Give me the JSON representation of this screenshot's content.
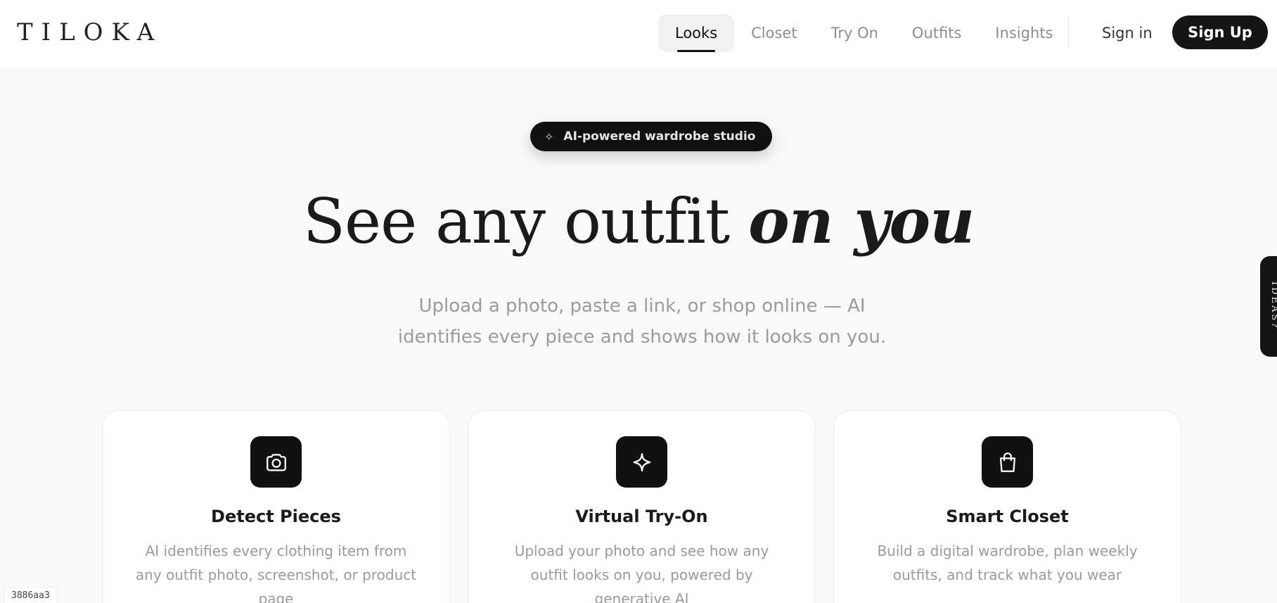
{
  "header": {
    "logo": "TILOKA",
    "nav": [
      {
        "label": "Looks",
        "active": true
      },
      {
        "label": "Closet",
        "active": false
      },
      {
        "label": "Try On",
        "active": false
      },
      {
        "label": "Outfits",
        "active": false
      },
      {
        "label": "Insights",
        "active": false
      }
    ],
    "sign_in": "Sign in",
    "sign_up": "Sign Up"
  },
  "hero": {
    "badge_icon": "sparkle-icon",
    "badge": "AI-powered wardrobe studio",
    "title_plain": "See any outfit",
    "title_emphasis": "on you",
    "subtitle": "Upload a photo, paste a link, or shop online — AI identifies every piece and shows how it looks on you."
  },
  "side_tab": {
    "label": "IDEAS?"
  },
  "features": [
    {
      "icon": "camera-icon",
      "title": "Detect Pieces",
      "description": "AI identifies every clothing item from any outfit photo, screenshot, or product page"
    },
    {
      "icon": "sparkle-icon",
      "title": "Virtual Try-On",
      "description": "Upload your photo and see how any outfit looks on you, powered by generative AI"
    },
    {
      "icon": "shopping-bag-icon",
      "title": "Smart Closet",
      "description": "Build a digital wardrobe, plan weekly outfits, and track what you wear"
    }
  ],
  "build_tag": "3886aa3",
  "colors": {
    "accent": "#111111",
    "background": "#f9f9f8",
    "muted_text": "#9b9b9b"
  }
}
